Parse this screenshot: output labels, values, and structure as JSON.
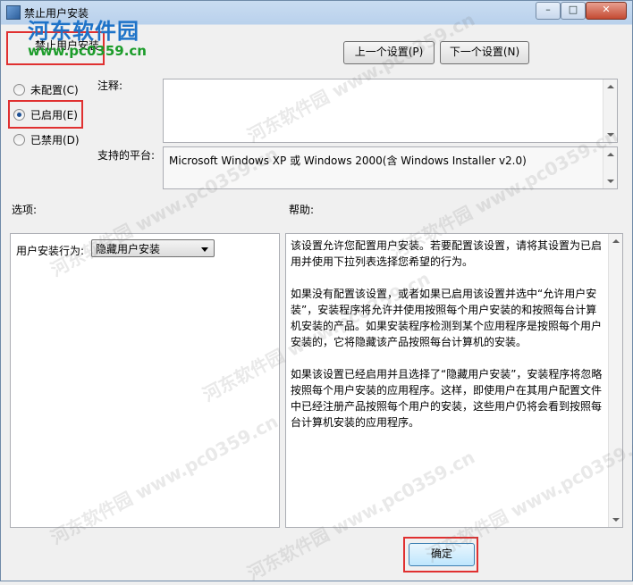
{
  "window": {
    "title": "禁止用户安装",
    "controls": {
      "minimize": "–",
      "maximize": "□",
      "close": "✕"
    }
  },
  "watermark": {
    "name": "河东软件园",
    "url": "www.pc0359.cn",
    "diagonal": "河东软件园  www.pc0359.cn"
  },
  "setting_name": "禁止用户安装",
  "nav": {
    "prev": "上一个设置(P)",
    "next": "下一个设置(N)"
  },
  "state": {
    "options": [
      {
        "label": "未配置(C)",
        "selected": false
      },
      {
        "label": "已启用(E)",
        "selected": true
      },
      {
        "label": "已禁用(D)",
        "selected": false
      }
    ]
  },
  "comment": {
    "label": "注释:",
    "value": ""
  },
  "platform": {
    "label": "支持的平台:",
    "value": "Microsoft Windows XP 或 Windows 2000(含 Windows Installer v2.0)"
  },
  "options_section": {
    "label": "选项:",
    "behavior_label": "用户安装行为:",
    "behavior_value": "隐藏用户安装"
  },
  "help_section": {
    "label": "帮助:",
    "paragraphs": [
      "该设置允许您配置用户安装。若要配置该设置，请将其设置为已启用并使用下拉列表选择您希望的行为。",
      "如果没有配置该设置，或者如果已启用该设置并选中“允许用户安装”，安装程序将允许并使用按照每个用户安装的和按照每台计算机安装的产品。如果安装程序检测到某个应用程序是按照每个用户安装的，它将隐藏该产品按照每台计算机的安装。",
      "如果该设置已经启用并且选择了“隐藏用户安装”，安装程序将忽略按照每个用户安装的应用程序。这样，即使用户在其用户配置文件中已经注册产品按照每个用户的安装，这些用户仍将会看到按照每台计算机安装的应用程序。"
    ]
  },
  "buttons": {
    "ok": "确定"
  },
  "colors": {
    "highlight_box": "#e03030",
    "watermark_blue": "#1e73c8",
    "watermark_green": "#1c9c2a"
  }
}
